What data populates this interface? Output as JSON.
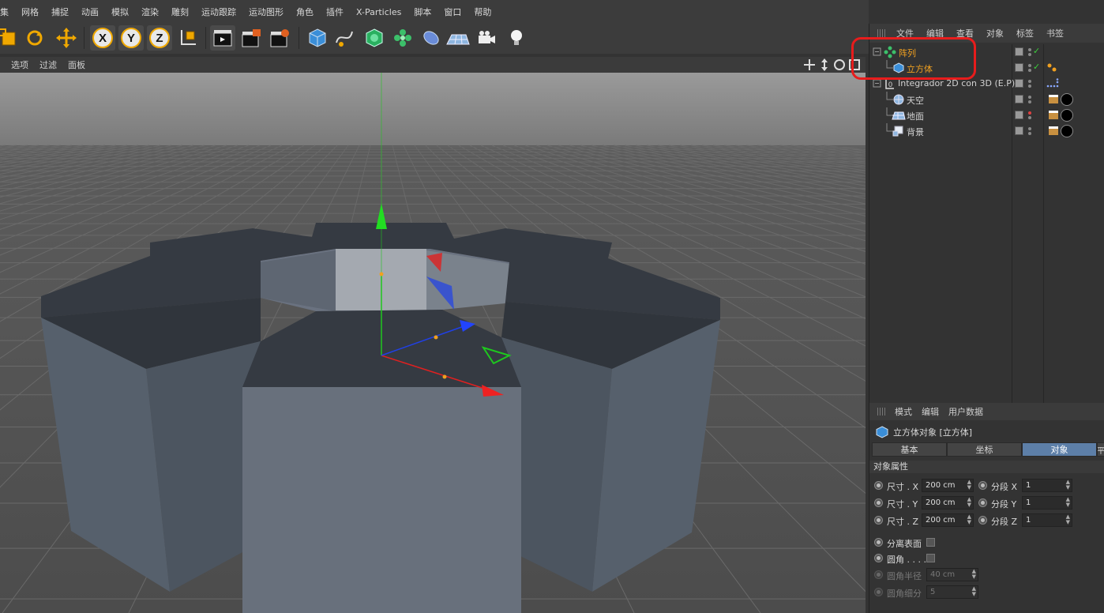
{
  "menubar": {
    "items": [
      "集",
      "网格",
      "捕捉",
      "动画",
      "模拟",
      "渲染",
      "雕刻",
      "运动跟踪",
      "运动图形",
      "角色",
      "插件",
      "X-Particles",
      "脚本",
      "窗口",
      "帮助"
    ]
  },
  "toolbar": {
    "axis_x": "X",
    "axis_y": "Y",
    "axis_z": "Z"
  },
  "viewport": {
    "menu": [
      "选项",
      "过滤",
      "面板"
    ]
  },
  "object_manager": {
    "menu": [
      "文件",
      "编辑",
      "查看",
      "对象",
      "标签",
      "书签"
    ],
    "objects": [
      {
        "name": "阵列",
        "selected": true
      },
      {
        "name": "立方体",
        "selected": true
      },
      {
        "name": "Integrador 2D con 3D (E.P)",
        "selected": false
      },
      {
        "name": "天空",
        "selected": false
      },
      {
        "name": "地面",
        "selected": false
      },
      {
        "name": "背景",
        "selected": false
      }
    ]
  },
  "attribute_manager": {
    "menu": [
      "模式",
      "编辑",
      "用户数据"
    ],
    "title": "立方体对象 [立方体]",
    "tabs": [
      "基本",
      "坐标",
      "对象",
      "平"
    ],
    "active_tab": "对象",
    "section": "对象属性",
    "size_x_label": "尺寸 . X",
    "size_x": "200 cm",
    "size_y_label": "尺寸 . Y",
    "size_y": "200 cm",
    "size_z_label": "尺寸 . Z",
    "size_z": "200 cm",
    "seg_x_label": "分段 X",
    "seg_x": "1",
    "seg_y_label": "分段 Y",
    "seg_y": "1",
    "seg_z_label": "分段 Z",
    "seg_z": "1",
    "separate_label": "分离表面",
    "fillet_label": "圆角 . . . .",
    "fillet_radius_label": "圆角半径",
    "fillet_radius": "40 cm",
    "fillet_sub_label": "圆角细分",
    "fillet_sub": "5"
  },
  "colors": {
    "accent_selected": "#f0a020",
    "active_tab": "#5d7fa8",
    "annotation": "#e81c1c"
  }
}
